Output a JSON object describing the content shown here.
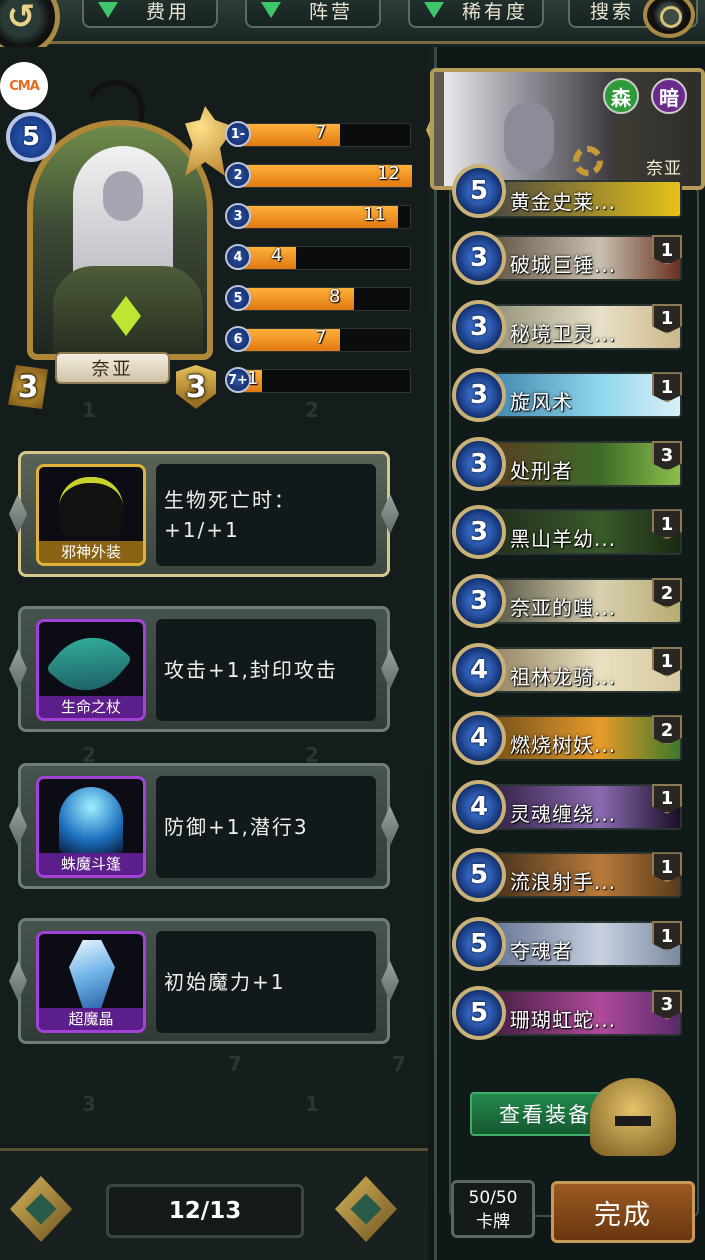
{
  "filters": {
    "cost": "费用",
    "faction": "阵营",
    "rarity": "稀有度",
    "search": "搜索"
  },
  "watermark": "CMA",
  "hero": {
    "name": "奈亚",
    "mana": "5",
    "attack": "3",
    "health": "3"
  },
  "mana_curve": [
    {
      "label": "1-",
      "value": 7
    },
    {
      "label": "2",
      "value": 12
    },
    {
      "label": "3",
      "value": 11
    },
    {
      "label": "4",
      "value": 4
    },
    {
      "label": "5",
      "value": 8
    },
    {
      "label": "6",
      "value": 7
    },
    {
      "label": "7+",
      "value": 1
    }
  ],
  "equipment": [
    {
      "name": "邪神外装",
      "desc": "生物死亡时：+1/+1"
    },
    {
      "name": "生命之杖",
      "desc": "攻击+1,封印攻击"
    },
    {
      "name": "蛛魔斗篷",
      "desc": "防御+1,潜行3"
    },
    {
      "name": "超魔晶",
      "desc": "初始魔力+1"
    }
  ],
  "hero_banner": {
    "name": "奈亚",
    "faction_1": "森",
    "faction_2": "暗"
  },
  "deck_partial": {
    "cost": "5",
    "name": "黄金史莱..."
  },
  "deck": [
    {
      "cost": "3",
      "name": "破城巨锤...",
      "count": "1"
    },
    {
      "cost": "3",
      "name": "秘境卫灵...",
      "count": "1"
    },
    {
      "cost": "3",
      "name": "旋风术",
      "count": "1"
    },
    {
      "cost": "3",
      "name": "处刑者",
      "count": "3"
    },
    {
      "cost": "3",
      "name": "黑山羊幼...",
      "count": "1"
    },
    {
      "cost": "3",
      "name": "奈亚的嗤...",
      "count": "2"
    },
    {
      "cost": "4",
      "name": "祖林龙骑...",
      "count": "1"
    },
    {
      "cost": "4",
      "name": "燃烧树妖...",
      "count": "2"
    },
    {
      "cost": "4",
      "name": "灵魂缠绕...",
      "count": "1"
    },
    {
      "cost": "5",
      "name": "流浪射手...",
      "count": "1"
    },
    {
      "cost": "5",
      "name": "夺魂者",
      "count": "1"
    },
    {
      "cost": "5",
      "name": "珊瑚虹蛇...",
      "count": "3"
    }
  ],
  "buttons": {
    "view_equipment": "查看装备",
    "done": "完成"
  },
  "deck_count": {
    "value": "50/50",
    "label": "卡牌"
  },
  "page": "12/13",
  "colors": {
    "curve_bar": "#f08a1c",
    "equip_border_selected": "#d6c58c",
    "icon_border": "#a242d6",
    "done_button": "#8a4a1a",
    "view_button": "#1f7a44"
  }
}
